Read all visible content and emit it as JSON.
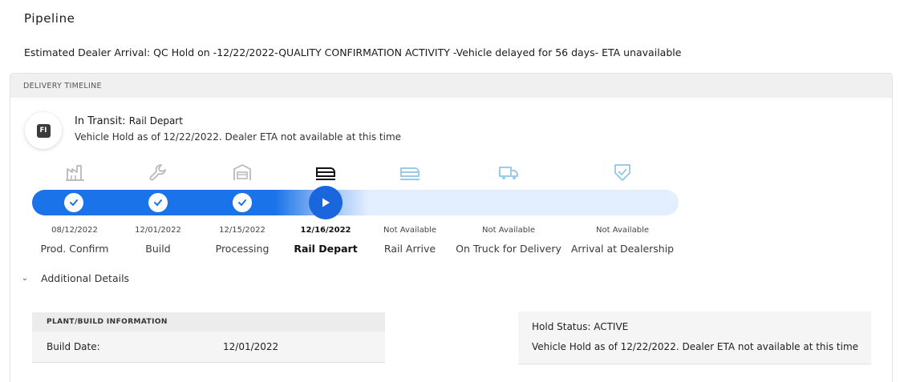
{
  "page": {
    "title": "Pipeline",
    "eta_text": "Estimated Dealer Arrival: QC Hold on -12/22/2022-QUALITY CONFIRMATION ACTIVITY -Vehicle delayed for 56 days- ETA unavailable"
  },
  "timeline": {
    "header": "DELIVERY TIMELINE",
    "status_badge": "FI",
    "status_label": "In Transit:",
    "status_value": "Rail Depart",
    "status_description": "Vehicle Hold as of 12/22/2022. Dealer ETA not available at this time",
    "progress_completed_steps": 4,
    "progress_total_steps": 7,
    "steps": [
      {
        "name": "Prod. Confirm",
        "date": "08/12/2022",
        "state": "complete",
        "icon": "factory-icon"
      },
      {
        "name": "Build",
        "date": "12/01/2022",
        "state": "complete",
        "icon": "wrench-icon"
      },
      {
        "name": "Processing",
        "date": "12/15/2022",
        "state": "complete",
        "icon": "garage-icon"
      },
      {
        "name": "Rail Depart",
        "date": "12/16/2022",
        "state": "current",
        "icon": "train-icon"
      },
      {
        "name": "Rail Arrive",
        "date": "Not Available",
        "state": "pending",
        "icon": "train-arrive-icon"
      },
      {
        "name": "On Truck for Delivery",
        "date": "Not Available",
        "state": "pending",
        "icon": "truck-icon"
      },
      {
        "name": "Arrival at Dealership",
        "date": "Not Available",
        "state": "pending",
        "icon": "shield-check-icon"
      }
    ],
    "colors": {
      "active": "#1a73e8",
      "pending_track": "#e3efff",
      "pending_icon": "#9ccbe8",
      "done_icon": "#b9b9b9"
    }
  },
  "details": {
    "toggle_label": "Additional Details",
    "plant": {
      "header": "PLANT/BUILD INFORMATION",
      "build_date_label": "Build Date:",
      "build_date_value": "12/01/2022"
    },
    "hold": {
      "status_line": "Hold Status: ACTIVE",
      "description": "Vehicle Hold as of 12/22/2022. Dealer ETA not available at this time"
    }
  }
}
